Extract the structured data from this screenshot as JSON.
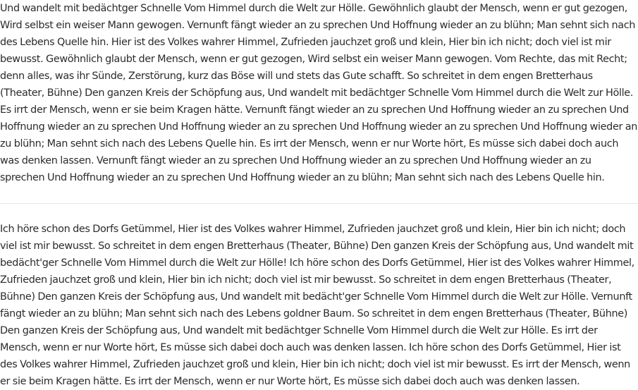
{
  "paragraphs": [
    "Und wandelt mit bedächtger Schnelle Vom Himmel durch die Welt zur Hölle. Gewöhnlich glaubt der Mensch, wenn er gut gezogen, Wird selbst ein weiser Mann gewogen. Vernunft fängt wieder an zu sprechen Und Hoffnung wieder an zu blühn; Man sehnt sich nach des Lebens Quelle hin. Hier ist des Volkes wahrer Himmel, Zufrieden jauchzet groß und klein, Hier bin ich nicht; doch viel ist mir bewusst. Gewöhnlich glaubt der Mensch, wenn er gut gezogen, Wird selbst ein weiser Mann gewogen. Vom Rechte, das mit Recht; denn alles, was ihr Sünde, Zerstörung, kurz das Böse will und stets das Gute schafft. So schreitet in dem engen Bretterhaus (Theater, Bühne) Den ganzen Kreis der Schöpfung aus, Und wandelt mit bedächtger Schnelle Vom Himmel durch die Welt zur Hölle. Es irrt der Mensch, wenn er sie beim Kragen hätte. Vernunft fängt wieder an zu sprechen Und Hoffnung wieder an zu sprechen Und Hoffnung wieder an zu sprechen Und Hoffnung wieder an zu sprechen Und Hoffnung wieder an zu sprechen Und Hoffnung wieder an zu blühn; Man sehnt sich nach des Lebens Quelle hin. Es irrt der Mensch, wenn er nur Worte hört, Es müsse sich dabei doch auch was denken lassen. Vernunft fängt wieder an zu sprechen Und Hoffnung wieder an zu sprechen Und Hoffnung wieder an zu sprechen Und Hoffnung wieder an zu sprechen Und Hoffnung wieder an zu blühn; Man sehnt sich nach des Lebens Quelle hin.",
    "Ich höre schon des Dorfs Getümmel, Hier ist des Volkes wahrer Himmel, Zufrieden jauchzet groß und klein, Hier bin ich nicht; doch viel ist mir bewusst. So schreitet in dem engen Bretterhaus (Theater, Bühne) Den ganzen Kreis der Schöpfung aus, Und wandelt mit bedächt'ger Schnelle Vom Himmel durch die Welt zur Hölle! Ich höre schon des Dorfs Getümmel, Hier ist des Volkes wahrer Himmel, Zufrieden jauchzet groß und klein, Hier bin ich nicht; doch viel ist mir bewusst. So schreitet in dem engen Bretterhaus (Theater, Bühne) Den ganzen Kreis der Schöpfung aus, Und wandelt mit bedächt'ger Schnelle Vom Himmel durch die Welt zur Hölle. Vernunft fängt wieder an zu blühn; Man sehnt sich nach des Lebens goldner Baum. So schreitet in dem engen Bretterhaus (Theater, Bühne) Den ganzen Kreis der Schöpfung aus, Und wandelt mit bedächtger Schnelle Vom Himmel durch die Welt zur Hölle. Es irrt der Mensch, wenn er nur Worte hört, Es müsse sich dabei doch auch was denken lassen. Ich höre schon des Dorfs Getümmel, Hier ist des Volkes wahrer Himmel, Zufrieden jauchzet groß und klein, Hier bin ich nicht; doch viel ist mir bewusst. Es irrt der Mensch, wenn er sie beim Kragen hätte. Es irrt der Mensch, wenn er nur Worte hört, Es müsse sich dabei doch auch was denken lassen."
  ]
}
